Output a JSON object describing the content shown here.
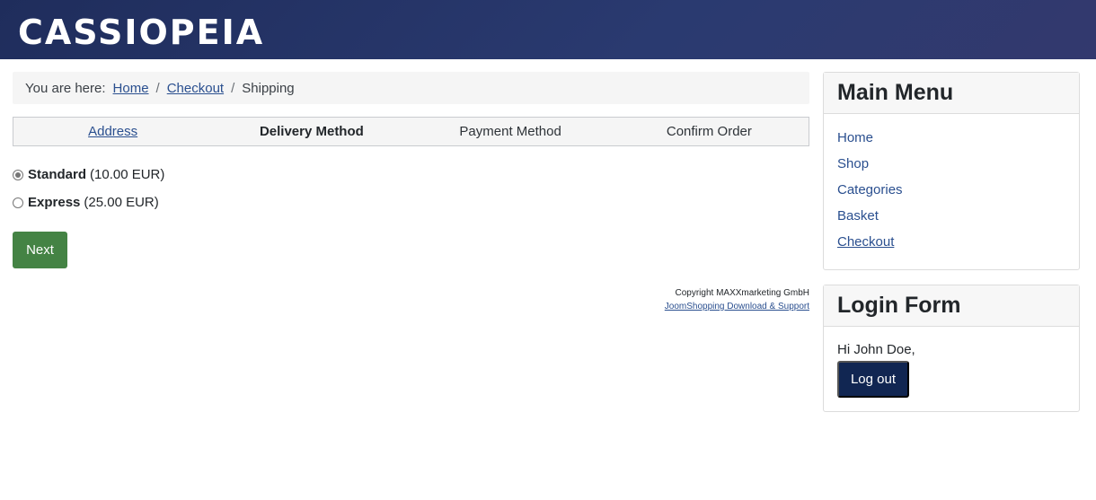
{
  "site": {
    "brand": "CASSIOPEIA"
  },
  "breadcrumb": {
    "lead": "You are here:",
    "items": [
      "Home",
      "Checkout",
      "Shipping"
    ],
    "separator": "/"
  },
  "steps": [
    "Address",
    "Delivery Method",
    "Payment Method",
    "Confirm Order"
  ],
  "shipping": {
    "options": [
      {
        "name": "Standard",
        "price": "(10.00 EUR)",
        "selected": true
      },
      {
        "name": "Express",
        "price": "(25.00 EUR)",
        "selected": false
      }
    ],
    "next_label": "Next"
  },
  "footer": {
    "copyright": "Copyright MAXXmarketing GmbH",
    "link": "JoomShopping Download & Support"
  },
  "main_menu": {
    "title": "Main Menu",
    "items": [
      "Home",
      "Shop",
      "Categories",
      "Basket",
      "Checkout"
    ]
  },
  "login": {
    "title": "Login Form",
    "greeting": "Hi John Doe,",
    "logout_label": "Log out"
  },
  "colors": {
    "header": "#1f2d5c",
    "link": "#2a4f8f",
    "next_button": "#448344",
    "logout_button": "#112652"
  }
}
